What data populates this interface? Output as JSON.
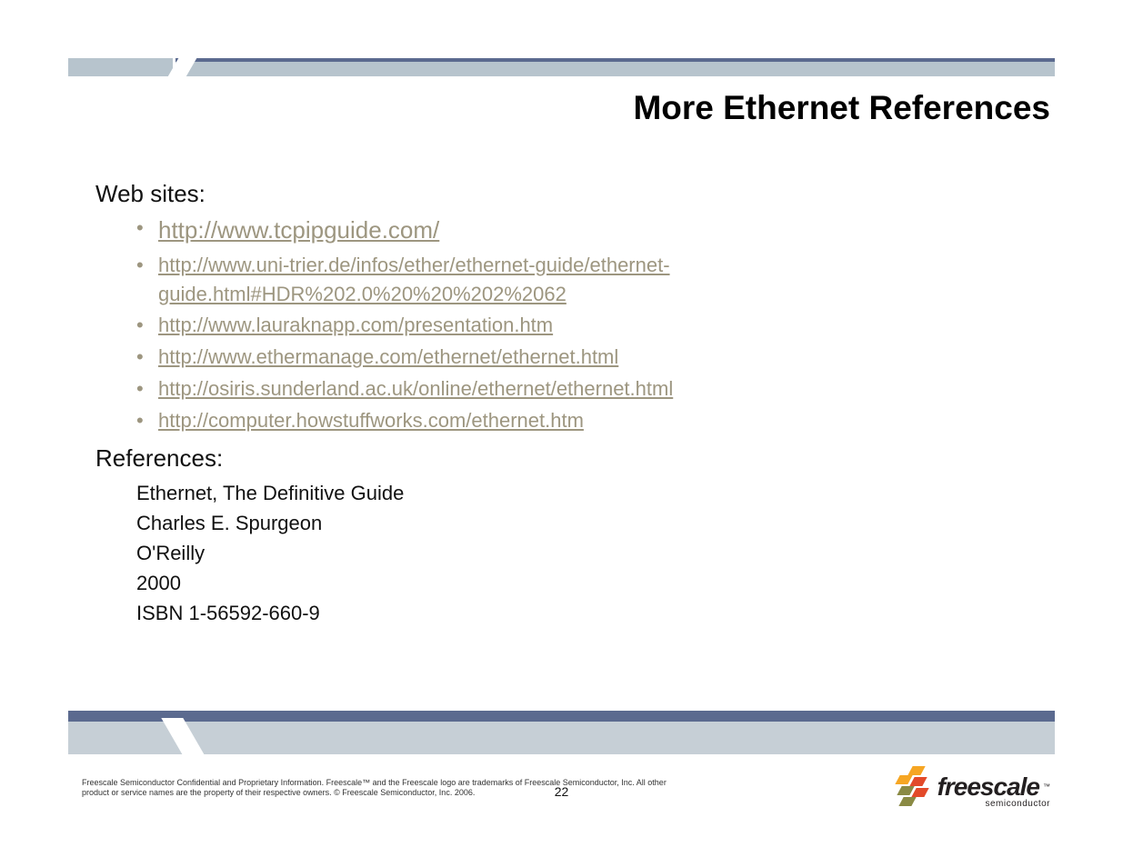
{
  "title": "More Ethernet References",
  "sections": {
    "websites_heading": "Web sites:",
    "references_heading": "References:"
  },
  "links": [
    "http://www.tcpipguide.com/",
    "http://www.uni-trier.de/infos/ether/ethernet-guide/ethernet-guide.html#HDR%202.0%20%20%202%2062",
    "http://www.lauraknapp.com/presentation.htm",
    "http://www.ethermanage.com/ethernet/ethernet.html",
    "http://osiris.sunderland.ac.uk/online/ethernet/ethernet.html",
    "http://computer.howstuffworks.com/ethernet.htm"
  ],
  "reference": {
    "title": "Ethernet, The Definitive Guide",
    "author": "Charles E. Spurgeon",
    "publisher": "O'Reilly",
    "year": "2000",
    "isbn": "ISBN 1-56592-660-9"
  },
  "footer": {
    "legal": "Freescale Semiconductor Confidential and Proprietary Information. Freescale™ and the Freescale logo are trademarks of Freescale Semiconductor, Inc. All other product or service names are the property of their respective owners. © Freescale Semiconductor, Inc. 2006.",
    "page": "22",
    "logo_brand": "freescale",
    "logo_sub": "semiconductor",
    "logo_tm": "™"
  }
}
